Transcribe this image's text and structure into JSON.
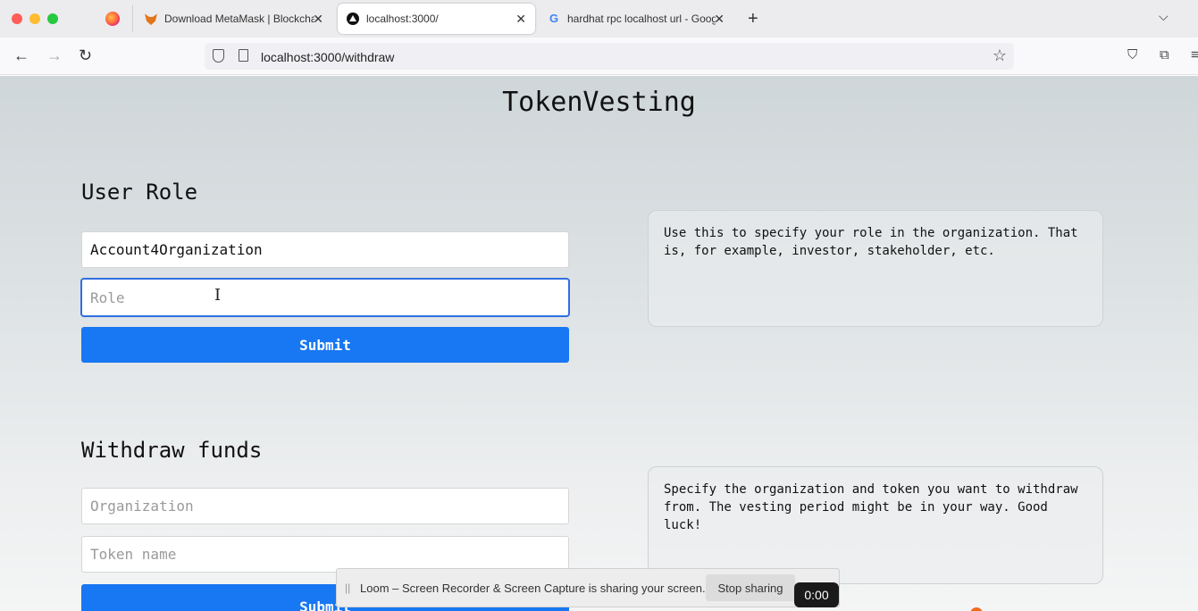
{
  "browser": {
    "tabs": [
      {
        "title": "Download MetaMask | Blockchain Wallet",
        "icon": "metamask-fox-icon"
      },
      {
        "title": "localhost:3000/",
        "icon": "localhost-triangle-icon",
        "active": true
      },
      {
        "title": "hardhat rpc localhost url - Google Search",
        "icon": "google-g-icon"
      }
    ],
    "url": "localhost:3000/withdraw"
  },
  "app": {
    "title": "TokenVesting",
    "user_role": {
      "heading": "User Role",
      "organization_value": "Account4Organization",
      "role_placeholder": "Role",
      "submit_label": "Submit",
      "info": "Use this to specify your role in the organization. That is, for example, investor, stakeholder, etc."
    },
    "withdraw": {
      "heading": "Withdraw funds",
      "organization_placeholder": "Organization",
      "token_placeholder": "Token name",
      "submit_label": "Submit",
      "info": "Specify the organization and token you want to withdraw from. The vesting period might be in your way. Good luck!"
    }
  },
  "loom_bar": {
    "message": "Loom – Screen Recorder & Screen Capture is sharing your screen.",
    "stop_label": "Stop sharing",
    "timer": "0:00"
  },
  "colors": {
    "primary_button": "#1877f2",
    "focus_border": "#2f6fe0"
  }
}
